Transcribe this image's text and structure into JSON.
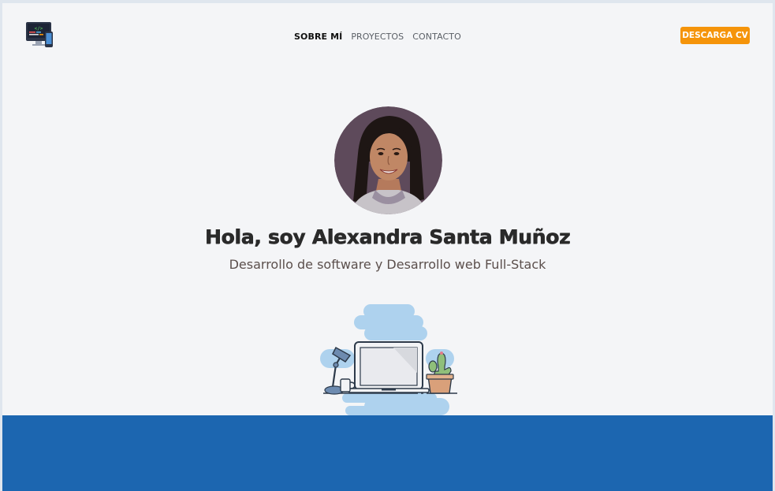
{
  "nav": {
    "items": [
      {
        "label": "SOBRE MÍ",
        "active": true
      },
      {
        "label": "PROYECTOS",
        "active": false
      },
      {
        "label": "CONTACTO",
        "active": false
      }
    ]
  },
  "header": {
    "cv_button": "DESCARGA CV",
    "logo_icon": "code-monitor-icon"
  },
  "hero": {
    "title": "Hola, soy Alexandra Santa Muñoz",
    "subtitle": "Desarrollo de software y Desarrollo web Full-Stack",
    "illustration": "desk-laptop-illustration"
  },
  "colors": {
    "accent": "#f5940a",
    "band": "#1c66b0",
    "background": "#f4f5f7"
  }
}
